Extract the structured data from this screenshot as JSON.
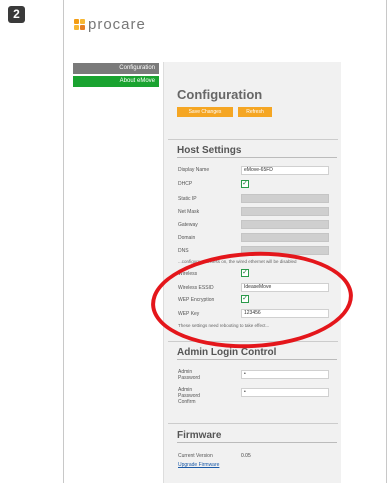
{
  "step": "2",
  "logo": {
    "text": "procare"
  },
  "nav": {
    "items": [
      {
        "label": "Configuration"
      },
      {
        "label": "About eMove"
      }
    ]
  },
  "page": {
    "title": "Configuration"
  },
  "toolbar": {
    "save_label": "Save Changes",
    "refresh_label": "Refresh"
  },
  "host_settings": {
    "title": "Host Settings",
    "display_name": {
      "label": "Display Name",
      "value": "eMove-65FD"
    },
    "dhcp": {
      "label": "DHCP",
      "checked": "✓"
    },
    "static_ip": {
      "label": "Static IP"
    },
    "net_mask": {
      "label": "Net Mask"
    },
    "gateway": {
      "label": "Gateway"
    },
    "domain": {
      "label": "Domain"
    },
    "dns": {
      "label": "DNS"
    },
    "note": "...configures wireless on, the wired ethernet will be disabled",
    "wireless": {
      "label": "Wireless",
      "checked": "✓"
    },
    "essid": {
      "label": "Wireless ESSID",
      "value": "IdeaseMove"
    },
    "wep_encryption": {
      "label": "WEP Encryption",
      "checked": "✓"
    },
    "wep_key": {
      "label": "WEP Key",
      "value": "123456"
    },
    "reboot_note": "These settings need rebooting to take effect..."
  },
  "admin": {
    "title": "Admin Login Control",
    "password": {
      "label_line1": "Admin",
      "label_line2": "Password",
      "value": "•"
    },
    "confirm": {
      "label_line1": "Admin",
      "label_line2": "Password",
      "label_line3": "Confirm",
      "value": "•"
    }
  },
  "firmware": {
    "title": "Firmware",
    "current_label": "Current Version",
    "current_value": "0.05",
    "upgrade_link": "Upgrade Firmware"
  },
  "colors": {
    "accent": "#f5a623",
    "nav_active": "#1aa330",
    "highlight": "#e4161b"
  }
}
